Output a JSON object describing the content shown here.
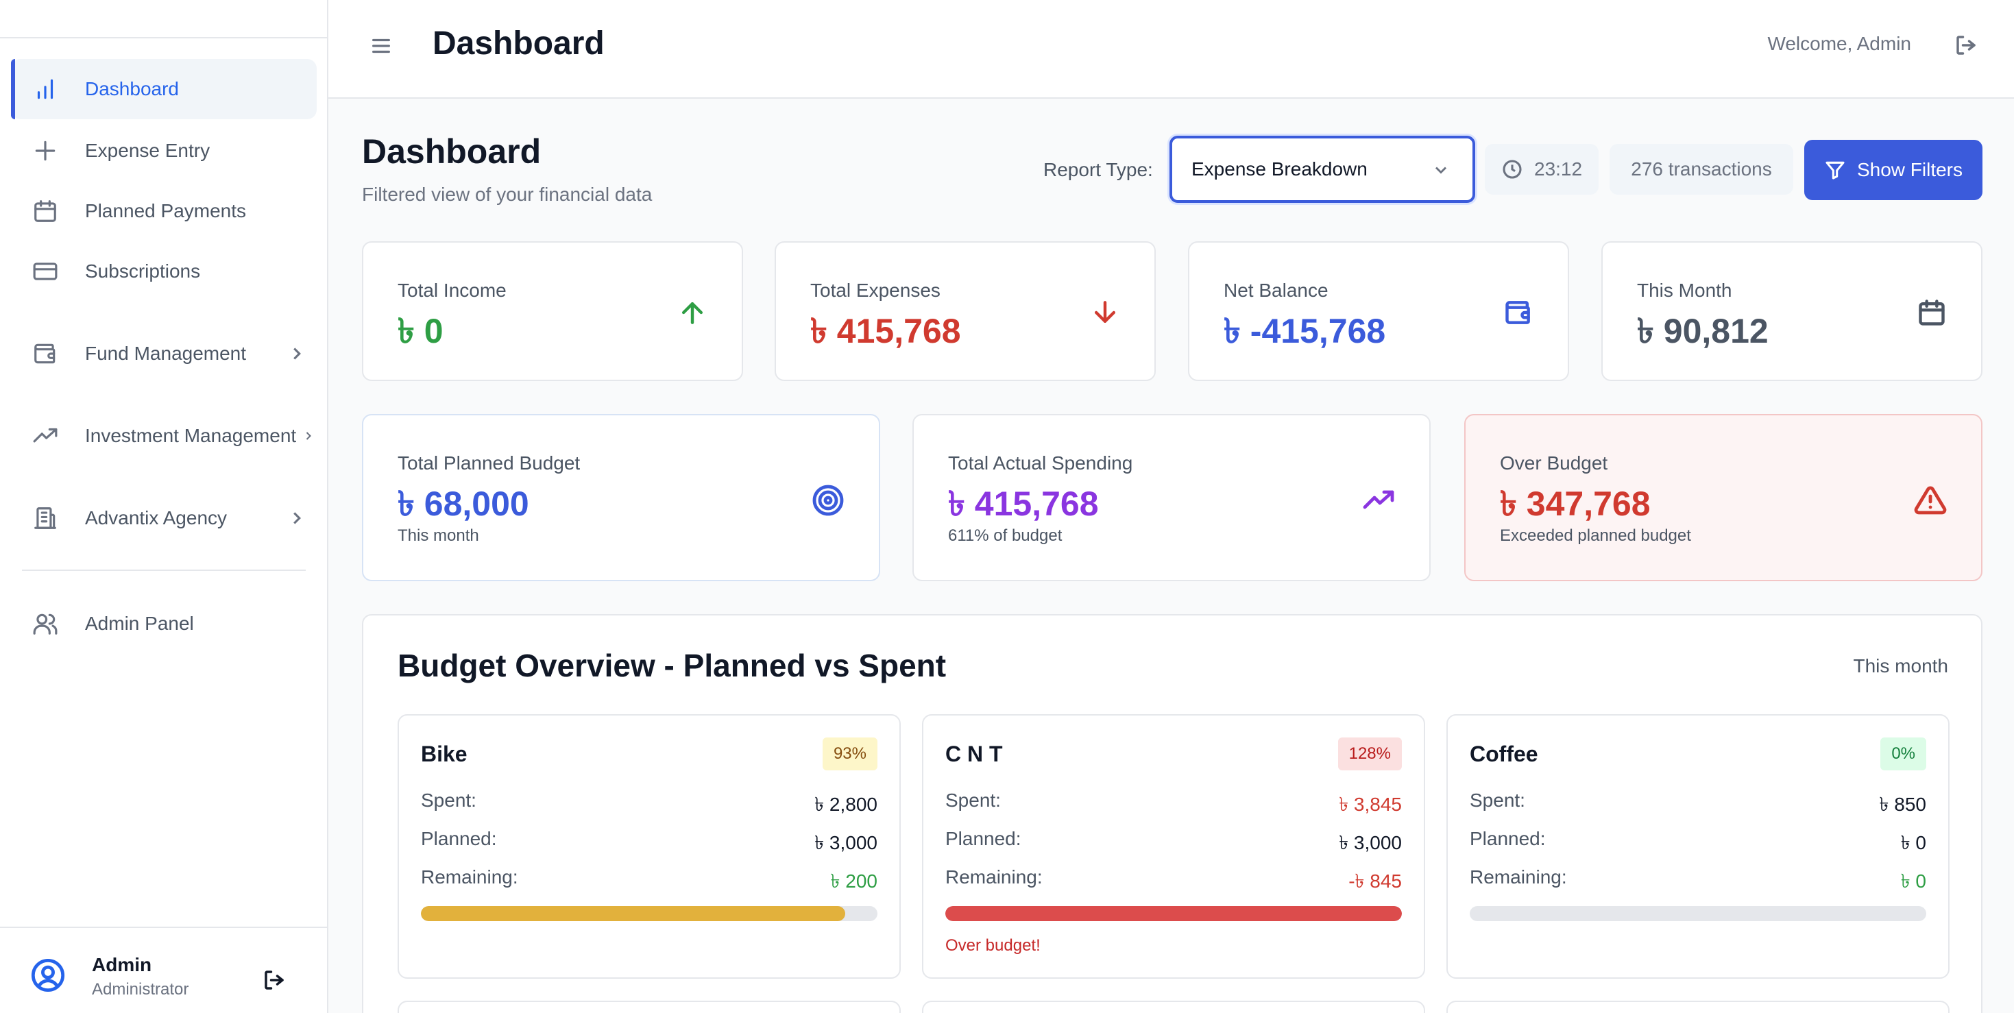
{
  "sidebar": {
    "items": [
      {
        "label": "Dashboard",
        "icon": "bar-chart-icon",
        "active": true
      },
      {
        "label": "Expense Entry",
        "icon": "plus-icon"
      },
      {
        "label": "Planned Payments",
        "icon": "calendar-icon"
      },
      {
        "label": "Subscriptions",
        "icon": "credit-card-icon"
      },
      {
        "label": "Fund Management",
        "icon": "wallet-icon",
        "expandable": true
      },
      {
        "label": "Investment Management",
        "icon": "trending-up-icon",
        "expandable": true
      },
      {
        "label": "Advantix Agency",
        "icon": "building-icon",
        "expandable": true
      },
      {
        "label": "Admin Panel",
        "icon": "users-icon"
      }
    ],
    "user": {
      "name": "Admin",
      "role": "Administrator"
    }
  },
  "header": {
    "title": "Dashboard",
    "welcome": "Welcome, Admin"
  },
  "main": {
    "title": "Dashboard",
    "subtitle": "Filtered view of your financial data",
    "report_type_label": "Report Type:",
    "report_type_value": "Expense Breakdown",
    "time": "23:12",
    "transactions": "276 transactions",
    "filters_button": "Show Filters"
  },
  "stats": [
    {
      "label": "Total Income",
      "value": "৳ 0",
      "color": "#2e9e44",
      "icon": "arrow-up-icon"
    },
    {
      "label": "Total Expenses",
      "value": "৳ 415,768",
      "color": "#d03a2f",
      "icon": "arrow-down-icon"
    },
    {
      "label": "Net Balance",
      "value": "৳ -415,768",
      "color": "#3b5bdb",
      "icon": "wallet-icon"
    },
    {
      "label": "This Month",
      "value": "৳ 90,812",
      "color": "#4b5563",
      "icon": "calendar-icon"
    }
  ],
  "budget_summary": [
    {
      "label": "Total Planned Budget",
      "value": "৳ 68,000",
      "note": "This month",
      "color": "#3b5bdb",
      "icon": "target-icon"
    },
    {
      "label": "Total Actual Spending",
      "value": "৳ 415,768",
      "note": "611% of budget",
      "color": "#8a35e0",
      "icon": "trending-up-icon"
    },
    {
      "label": "Over Budget",
      "value": "৳ 347,768",
      "note": "Exceeded planned budget",
      "color": "#d03a2f",
      "icon": "warning-icon"
    }
  ],
  "overview": {
    "title": "Budget Overview - Planned vs Spent",
    "period": "This month",
    "row_labels": {
      "spent": "Spent:",
      "planned": "Planned:",
      "remaining": "Remaining:"
    },
    "over_note": "Over budget!",
    "categories": [
      {
        "name": "Bike",
        "percent": "93%",
        "spent": "৳ 2,800",
        "planned": "৳ 3,000",
        "remaining": "৳ 200",
        "progress": 0.93,
        "bar_color": "#e2b13c"
      },
      {
        "name": "C N T",
        "percent": "128%",
        "spent": "৳ 3,845",
        "planned": "৳ 3,000",
        "remaining": "-৳ 845",
        "progress": 1.0,
        "bar_color": "#dc4c4c"
      },
      {
        "name": "Coffee",
        "percent": "0%",
        "spent": "৳ 850",
        "planned": "৳ 0",
        "remaining": "৳ 0",
        "progress": 0,
        "bar_color": "#e5e7eb"
      }
    ]
  }
}
